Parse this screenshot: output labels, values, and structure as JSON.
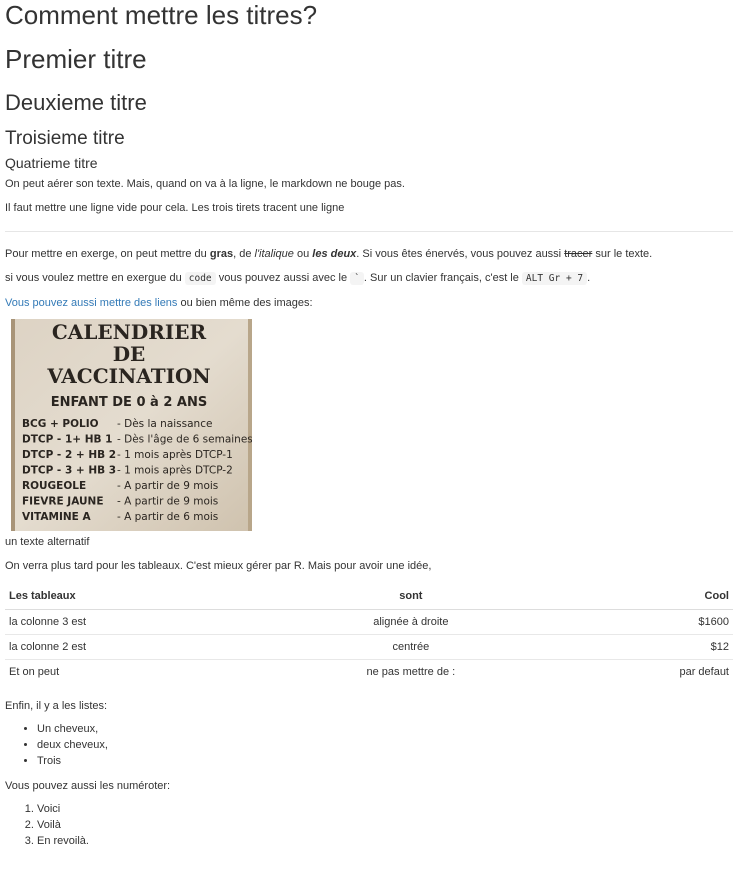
{
  "headings": {
    "h1": "Comment mettre les titres?",
    "h2": "Premier titre",
    "h3": "Deuxieme titre",
    "h4": "Troisieme titre",
    "h5": "Quatrieme titre"
  },
  "intro": {
    "line1": "On peut aérer son texte. Mais, quand on va à la ligne, le markdown ne bouge pas.",
    "line2": "Il faut mettre une ligne vide pour cela. Les trois tirets tracent une ligne"
  },
  "emphasis": {
    "prefix": "Pour mettre en exerge, on peut mettre du ",
    "bold": "gras",
    "sep1": ", de ",
    "italic": "l'italique",
    "sep2": " ou ",
    "bolditalic": "les deux",
    "sep3": ". Si vous êtes énervés, vous pouvez aussi ",
    "strike": "tracer",
    "suffix": " sur le texte."
  },
  "code_line": {
    "prefix": "si vous voulez mettre en exergue du ",
    "code1": "code",
    "mid": " vous pouvez aussi avec le ",
    "code2": "`",
    "mid2": ". Sur un clavier français, c'est le ",
    "code3": "ALT Gr + 7",
    "suffix": "."
  },
  "link_line": {
    "link": "Vous pouvez aussi mettre des liens",
    "suffix": " ou bien même des images:"
  },
  "image": {
    "lines": [
      "CALENDRIER",
      "DE",
      "VACCINATION",
      "ENFANT DE 0 à 2 ANS"
    ],
    "rows": [
      {
        "left": "BCG + POLIO",
        "right": "- Dès la naissance"
      },
      {
        "left": "DTCP - 1+ HB 1",
        "right": "- Dès l'âge de 6 semaines"
      },
      {
        "left": "DTCP - 2  + HB 2",
        "right": "- 1 mois après DTCP-1"
      },
      {
        "left": "DTCP - 3 + HB 3",
        "right": "- 1 mois après DTCP-2"
      },
      {
        "left": "ROUGEOLE",
        "right": "- A partir de 9 mois"
      },
      {
        "left": "FIEVRE JAUNE",
        "right": "- A partir de 9 mois"
      },
      {
        "left": "VITAMINE A",
        "right": "- A partir de 6 mois"
      }
    ]
  },
  "alt_text": "un texte alternatif",
  "table_intro": "On verra plus tard pour les tableaux. C'est mieux gérer par R. Mais pour avoir une idée,",
  "table": {
    "headers": [
      "Les tableaux",
      "sont",
      "Cool"
    ],
    "rows": [
      [
        "la colonne 3 est",
        "alignée à droite",
        "$1600"
      ],
      [
        "la colonne 2 est",
        "centrée",
        "$12"
      ],
      [
        "Et on peut",
        "ne pas mettre de :",
        "par defaut"
      ]
    ]
  },
  "lists_intro": "Enfin, il y a les listes:",
  "bullets": [
    "Un cheveux,",
    "deux cheveux,",
    "Trois"
  ],
  "numbered_intro": "Vous pouvez aussi les numéroter:",
  "numbered": [
    "Voici",
    "Voilà",
    "En revoilà."
  ],
  "colors": {
    "link": "#337ab7",
    "text": "#333333"
  }
}
